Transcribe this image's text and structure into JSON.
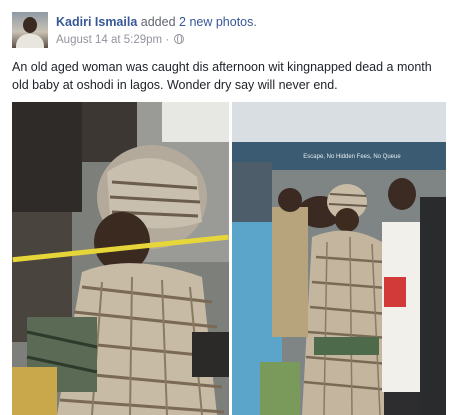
{
  "post": {
    "author": "Kadiri Ismaila",
    "action_prefix": " added ",
    "action_count": "2 new photos",
    "action_suffix": ".",
    "timestamp": "August 14 at 5:29pm",
    "separator": " · ",
    "privacy_icon": "globe-icon",
    "caption": "An old aged woman was caught dis afternoon wit kingnapped dead a month old baby at oshodi in lagos. Wonder dry say will never end."
  },
  "photos": {
    "right_banner_text": "Escape, No Hidden Fees, No Queue"
  },
  "colors": {
    "link": "#365899",
    "meta": "#90949c",
    "text": "#1d2129"
  }
}
